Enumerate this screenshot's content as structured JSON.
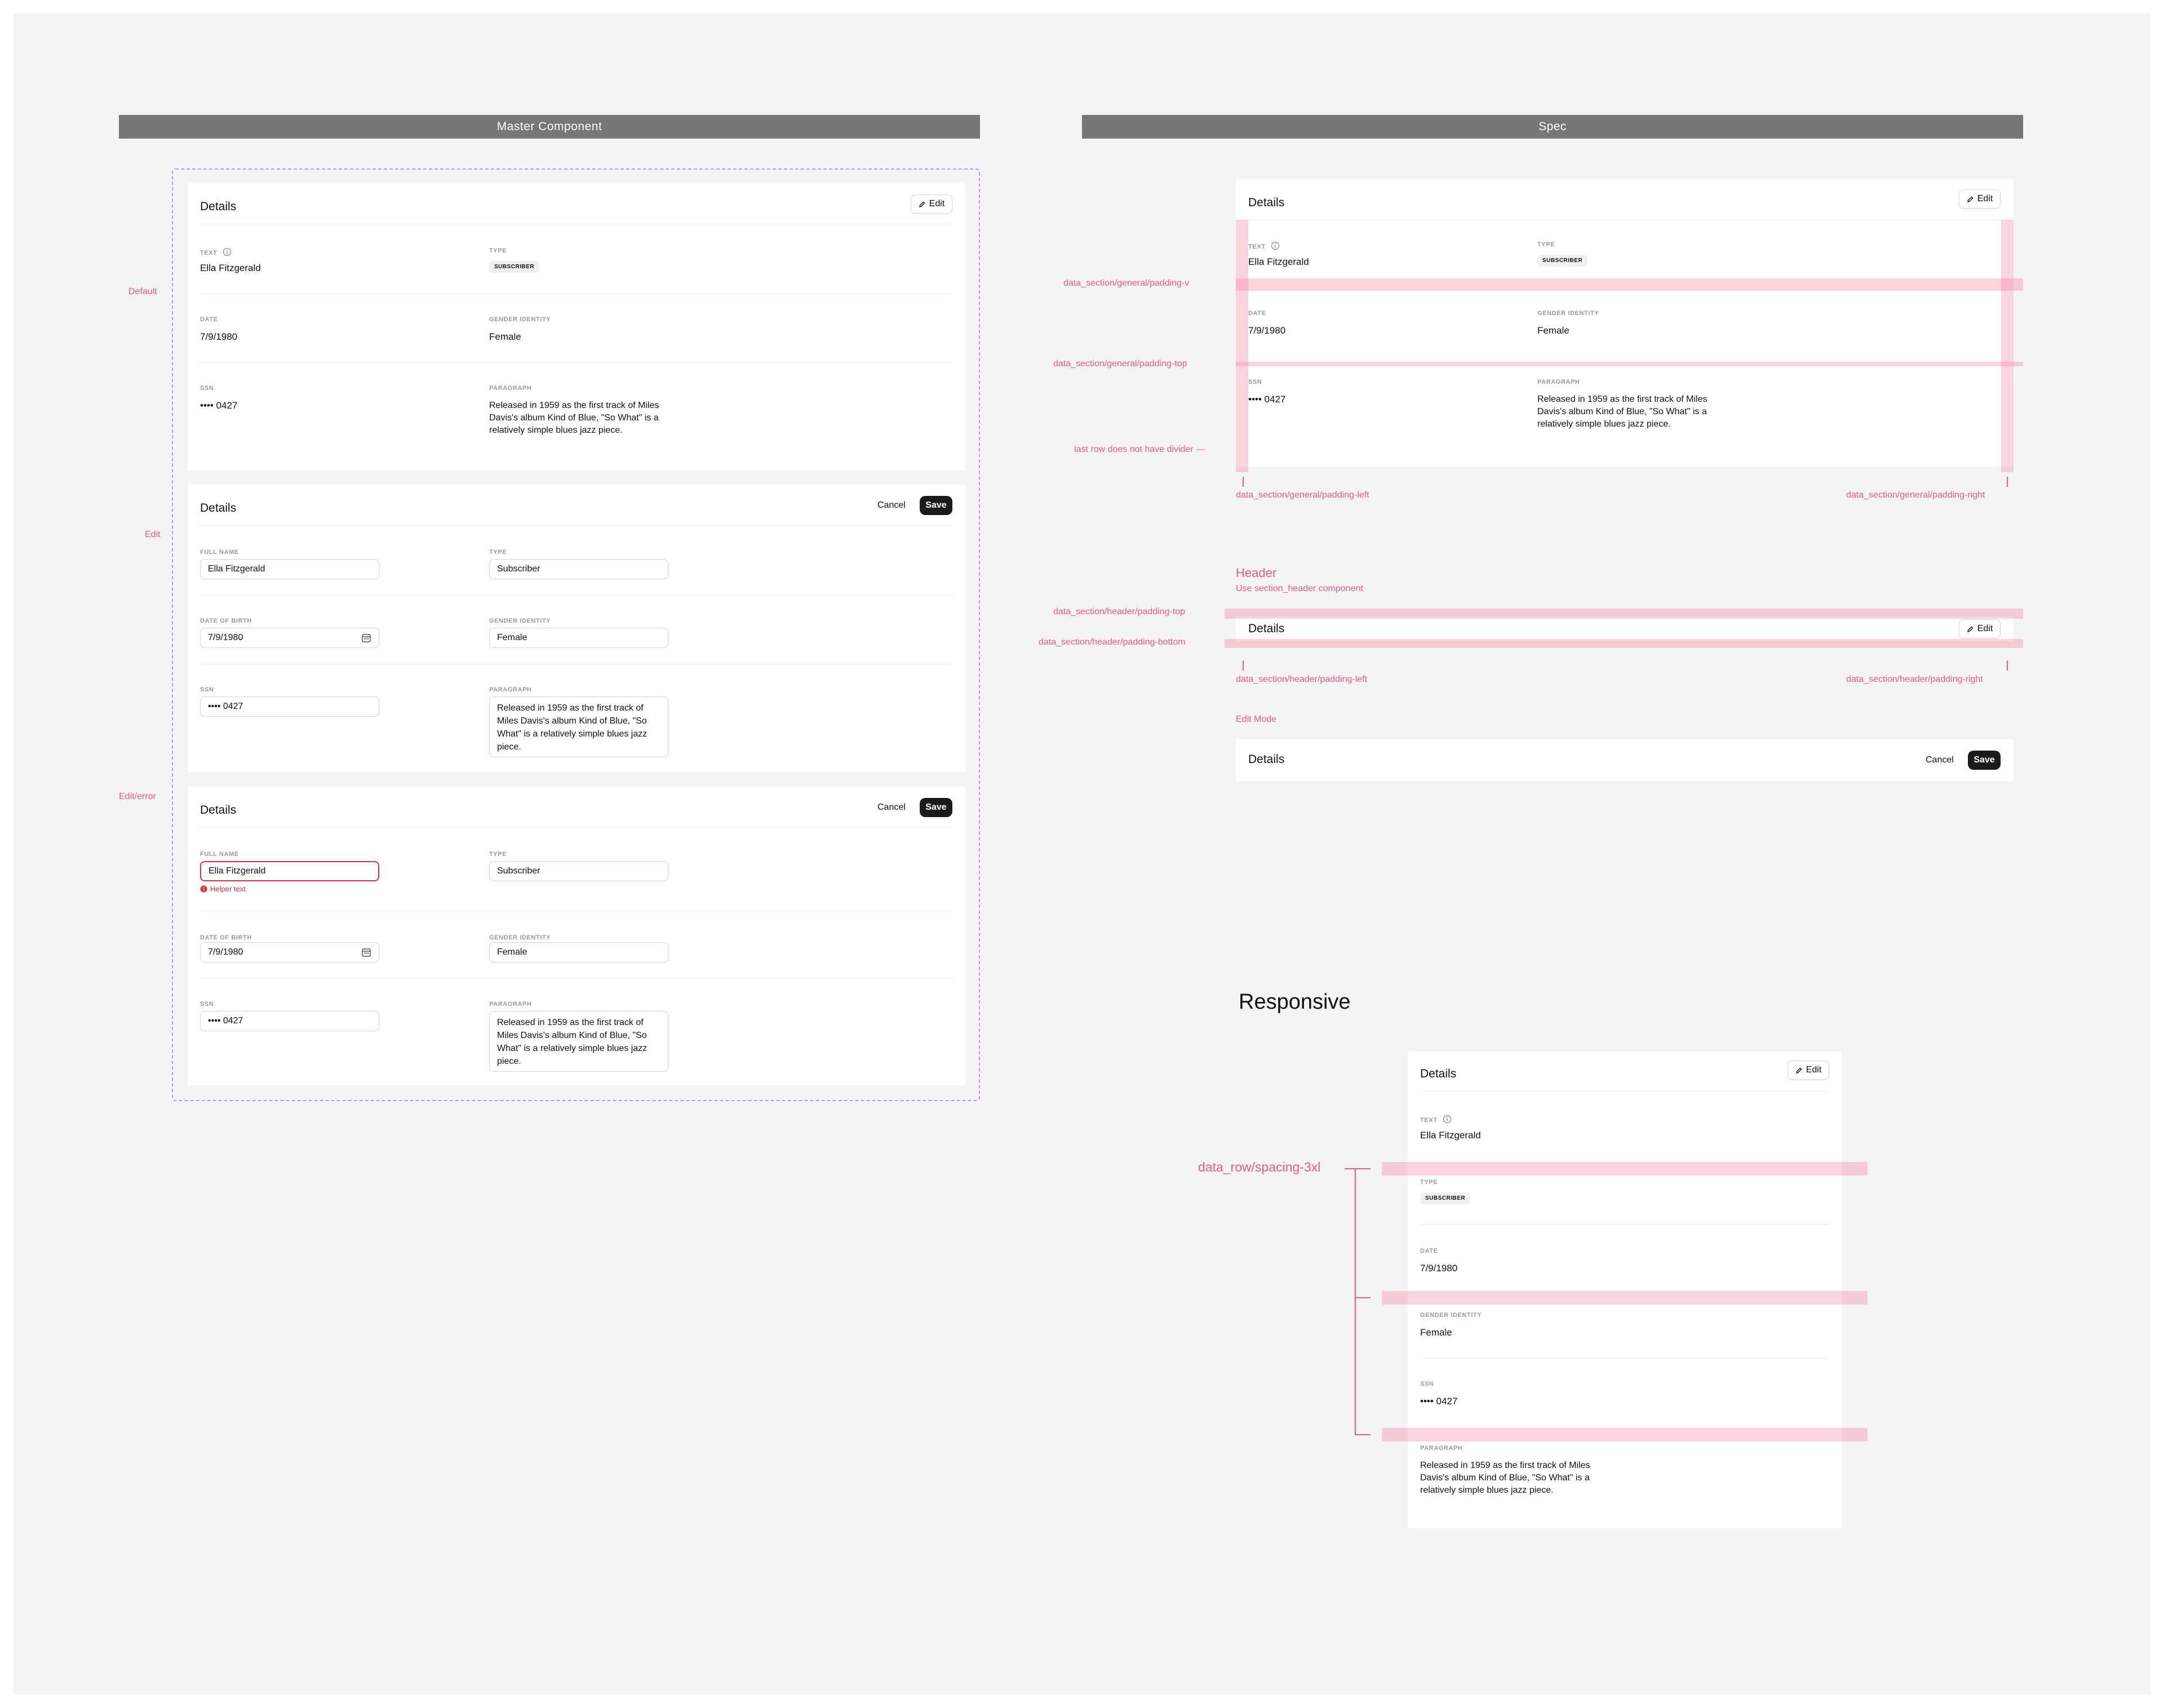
{
  "master": {
    "title": "Master Component",
    "state_labels": {
      "default": "Default",
      "edit": "Edit",
      "error": "Edit/error"
    },
    "default": {
      "title": "Details",
      "edit_label": "Edit",
      "text_label": "TEXT",
      "text_value": "Ella Fitzgerald",
      "type_label": "TYPE",
      "type_value": "SUBSCRIBER",
      "date_label": "DATE",
      "date_value": "7/9/1980",
      "gender_label": "GENDER IDENTITY",
      "gender_value": "Female",
      "ssn_label": "SSN",
      "ssn_value": "•••• 0427",
      "paragraph_label": "PARAGRAPH",
      "paragraph_value": "Released in 1959 as the first track of Miles Davis's album Kind of Blue, \"So What\" is a relatively simple blues jazz piece."
    },
    "edit": {
      "title": "Details",
      "cancel_label": "Cancel",
      "save_label": "Save",
      "name_label": "FULL NAME",
      "name_value": "Ella Fitzgerald",
      "type_label": "TYPE",
      "type_value": "Subscriber",
      "dob_label": "DATE OF BIRTH",
      "dob_value": "7/9/1980",
      "gender_label": "GENDER IDENTITY",
      "gender_value": "Female",
      "ssn_label": "SSN",
      "ssn_value": "•••• 0427",
      "paragraph_label": "PARAGRAPH",
      "paragraph_value": "Released in 1959 as the first track of Miles Davis's album Kind of Blue, \"So What\" is a relatively simple blues jazz piece."
    },
    "error": {
      "title": "Details",
      "cancel_label": "Cancel",
      "save_label": "Save",
      "name_label": "FULL NAME",
      "name_value": "Ella Fitzgerald",
      "helper_text": "Helper text",
      "type_label": "TYPE",
      "type_value": "Subscriber",
      "dob_label": "DATE OF BIRTH",
      "dob_value": "7/9/1980",
      "gender_label": "GENDER IDENTITY",
      "gender_value": "Female",
      "ssn_label": "SSN",
      "ssn_value": "•••• 0427",
      "paragraph_label": "PARAGRAPH",
      "paragraph_value": "Released in 1959 as the first track of Miles Davis's album Kind of Blue, \"So What\" is a relatively simple blues jazz piece."
    }
  },
  "spec": {
    "title": "Spec",
    "card": {
      "title": "Details",
      "edit_label": "Edit",
      "text_label": "TEXT",
      "text_value": "Ella Fitzgerald",
      "type_label": "TYPE",
      "type_value": "SUBSCRIBER",
      "date_label": "DATE",
      "date_value": "7/9/1980",
      "gender_label": "GENDER IDENTITY",
      "gender_value": "Female",
      "ssn_label": "SSN",
      "ssn_value": "•••• 0427",
      "paragraph_label": "PARAGRAPH",
      "paragraph_value": "Released in 1959 as the first track of Miles Davis's album Kind of Blue, \"So What\" is a relatively simple blues jazz piece."
    },
    "annotations": {
      "padding_v": "data_section/general/padding-v",
      "padding_top": "data_section/general/padding-top",
      "last_row": "last row does not have divider —",
      "padding_left": "data_section/general/padding-left",
      "padding_right": "data_section/general/padding-right",
      "header_title": "Header",
      "header_sub": "Use section_header component",
      "header_padding_top": "data_section/header/padding-top",
      "header_padding_bottom": "data_section/header/padding-bottom",
      "header_padding_left": "data_section/header/padding-left",
      "header_padding_right": "data_section/header/padding-right",
      "edit_mode": "Edit Mode"
    },
    "header_card": {
      "title": "Details",
      "edit_label": "Edit"
    },
    "edit_card": {
      "title": "Details",
      "cancel_label": "Cancel",
      "save_label": "Save"
    }
  },
  "responsive": {
    "heading": "Responsive",
    "spacing_label": "data_row/spacing-3xl",
    "card": {
      "title": "Details",
      "edit_label": "Edit",
      "text_label": "TEXT",
      "text_value": "Ella Fitzgerald",
      "type_label": "TYPE",
      "type_value": "SUBSCRIBER",
      "date_label": "DATE",
      "date_value": "7/9/1980",
      "gender_label": "GENDER IDENTITY",
      "gender_value": "Female",
      "ssn_label": "SSN",
      "ssn_value": "•••• 0427",
      "paragraph_label": "PARAGRAPH",
      "paragraph_value": "Released in 1959 as the first track of Miles Davis's album Kind of Blue, \"So What\" is a relatively simple blues jazz piece."
    }
  },
  "colors": {
    "accent_pink": "#f05a86",
    "error_red": "#e0303d",
    "topbar_gray": "#767676",
    "dashed_purple": "#b89af0"
  },
  "icons": [
    "pencil-icon",
    "info-icon",
    "calendar-icon",
    "error-icon"
  ]
}
